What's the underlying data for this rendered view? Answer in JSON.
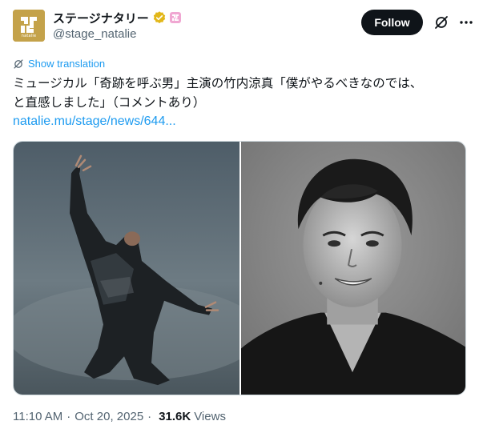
{
  "author": {
    "display_name": "ステージナタリー",
    "handle": "@stage_natalie",
    "avatar_text": "natalie",
    "verified_badge_color": "#e2b719",
    "affiliation_badge_color": "#f0a7d2"
  },
  "actions": {
    "follow_label": "Follow",
    "grok_icon": "grok-icon",
    "more_icon": "more-icon"
  },
  "translation": {
    "label": "Show translation",
    "color": "#1d9bf0"
  },
  "tweet": {
    "text": "ミュージカル「奇跡を呼ぶ男」主演の竹内涼真「僕がやるべきなのでは、\nと直感しました」（コメントあり）",
    "link": "natalie.mu/stage/news/644..."
  },
  "media": {
    "image_count": 2
  },
  "meta": {
    "time": "11:10 AM",
    "date": "Oct 20, 2025",
    "views_count": "31.6K",
    "views_label": "Views"
  }
}
